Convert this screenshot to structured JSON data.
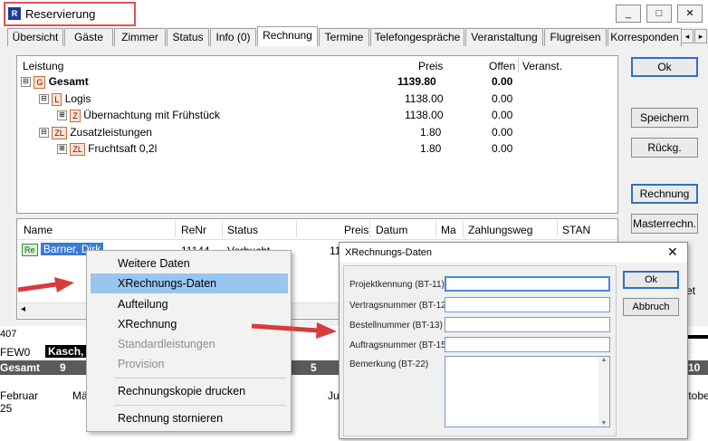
{
  "window": {
    "title": "Reservierung",
    "app_icon": "app-icon",
    "controls": [
      "_",
      "□",
      "✕"
    ]
  },
  "tabs": [
    "Übersicht",
    "Gäste",
    "Zimmer",
    "Status",
    "Info (0)",
    "Rechnung",
    "Termine",
    "Telefongespräche",
    "Veranstaltung",
    "Flugreisen",
    "Korresponden"
  ],
  "active_tab": "Rechnung",
  "tab_scroll": [
    "◂",
    "▸"
  ],
  "services": {
    "headers": {
      "leistung": "Leistung",
      "preis": "Preis",
      "offen": "Offen",
      "veranst": "Veranst."
    },
    "rows": [
      {
        "tree": "⊟",
        "badge": "G",
        "label": "Gesamt",
        "preis": "1139.80",
        "offen": "0.00"
      },
      {
        "tree": "⊟",
        "badge": "L",
        "label": "Logis",
        "preis": "1138.00",
        "offen": "0.00"
      },
      {
        "tree": "⊞",
        "badge": "Z",
        "label": "Übernachtung mit Frühstück",
        "preis": "1138.00",
        "offen": "0.00"
      },
      {
        "tree": "⊟",
        "badge": "ZL",
        "label": "Zusatzleistungen",
        "preis": "1.80",
        "offen": "0.00"
      },
      {
        "tree": "⊞",
        "badge": "ZL",
        "label": "Fruchtsaft 0,2l",
        "preis": "1.80",
        "offen": "0.00"
      }
    ]
  },
  "side_buttons": {
    "ok": "Ok",
    "speichern": "Speichern",
    "rueckg": "Rückg.",
    "rechnung": "Rechnung",
    "masterrechn": "Masterrechn."
  },
  "invoices": {
    "headers": {
      "name": "Name",
      "renr": "ReNr",
      "status": "Status",
      "preis": "Preis",
      "datum": "Datum",
      "ma": "Ma",
      "zahlungsweg": "Zahlungsweg",
      "stan": "STAN"
    },
    "row": {
      "badge": "Re",
      "name": "Barner, Dirk",
      "renr": "11144",
      "status": "Verbucht",
      "preis": "11"
    }
  },
  "context_menu": {
    "items": [
      {
        "label": "Weitere Daten",
        "state": "normal"
      },
      {
        "label": "XRechnungs-Daten",
        "state": "selected"
      },
      {
        "label": "Aufteilung",
        "state": "normal"
      },
      {
        "label": "XRechnung",
        "state": "normal"
      },
      {
        "label": "Standardleistungen",
        "state": "disabled"
      },
      {
        "label": "Provision",
        "state": "disabled"
      },
      {
        "label": "Rechnungskopie drucken",
        "state": "normal"
      },
      {
        "label": "Rechnung stornieren",
        "state": "normal"
      }
    ]
  },
  "dialog": {
    "title": "XRechnungs-Daten",
    "close": "✕",
    "fields": [
      {
        "label": "Projektkennung (BT-11)",
        "value": ""
      },
      {
        "label": "Vertragsnummer (BT-12)",
        "value": ""
      },
      {
        "label": "Bestellnummer (BT-13)",
        "value": ""
      },
      {
        "label": "Auftragsnummer (BT-15)",
        "value": ""
      }
    ],
    "remark_label": "Bemerkung (BT-22)",
    "ok": "Ok",
    "cancel": "Abbruch"
  },
  "schedule": {
    "row1_label": "FEW0",
    "row1_chip": "Kasch, C",
    "bar_label": "Gesamt",
    "bar_values": [
      "9",
      "5",
      "10"
    ],
    "months": [
      "Februar",
      "Mä",
      "Ju",
      "Oktober"
    ],
    "day": "25",
    "snippet_top": "407"
  },
  "colors": {
    "annotation_red": "#e05252",
    "selection": "#99c6f0",
    "dark_bar": "#5a5a5a",
    "badge_fill": "#fbe3d4"
  },
  "partial_text": "et"
}
